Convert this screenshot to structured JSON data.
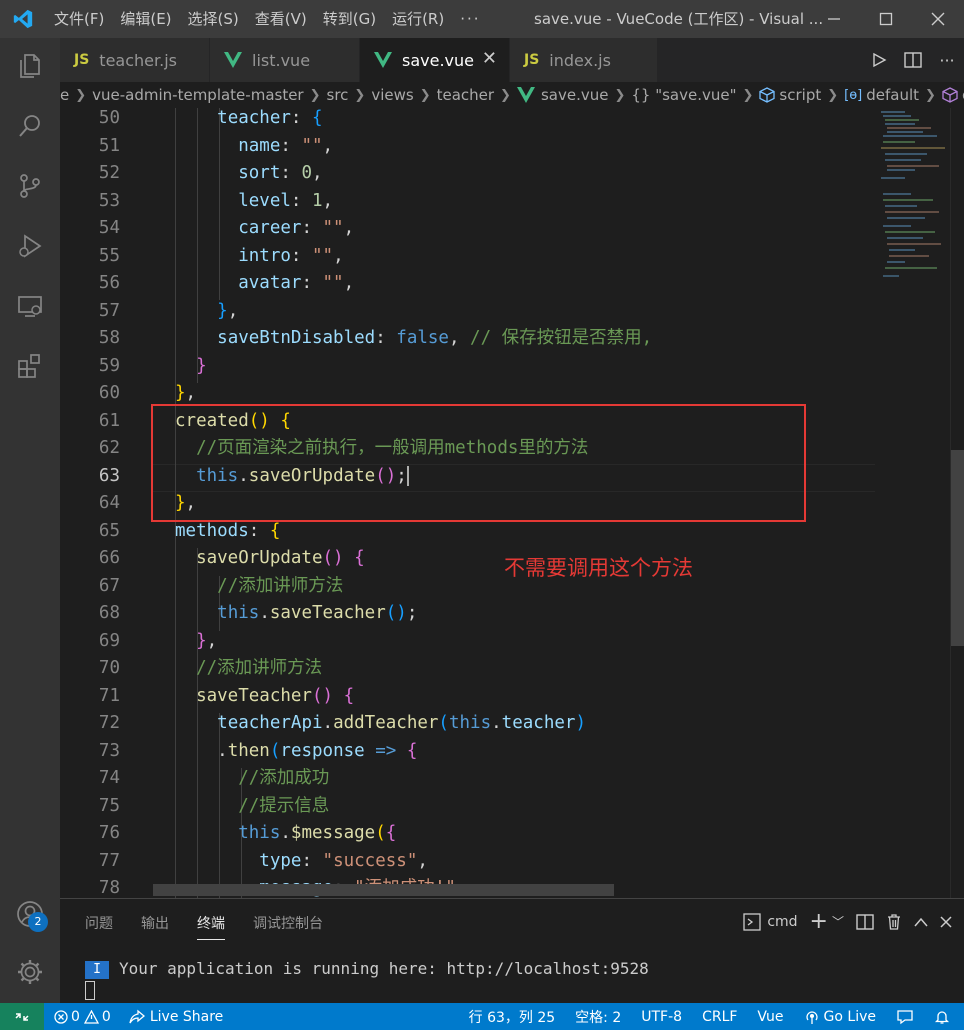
{
  "titlebar": {
    "menu": [
      "文件(F)",
      "编辑(E)",
      "选择(S)",
      "查看(V)",
      "转到(G)",
      "运行(R)"
    ],
    "more": "···",
    "title": "save.vue - VueCode (工作区) - Visual ..."
  },
  "tabs": [
    {
      "label": "teacher.js",
      "kind": "js",
      "active": false
    },
    {
      "label": "list.vue",
      "kind": "vue",
      "active": false
    },
    {
      "label": "save.vue",
      "kind": "vue",
      "active": true
    },
    {
      "label": "index.js",
      "kind": "js",
      "active": false
    }
  ],
  "breadcrumb": [
    "e",
    "vue-admin-template-master",
    "src",
    "views",
    "teacher",
    "save.vue",
    "{} \"save.vue\"",
    "script",
    "default",
    "created"
  ],
  "editor": {
    "current_line": 63,
    "lines": [
      {
        "n": "50"
      },
      {
        "n": "51"
      },
      {
        "n": "52"
      },
      {
        "n": "53"
      },
      {
        "n": "54"
      },
      {
        "n": "55"
      },
      {
        "n": "56"
      },
      {
        "n": "57"
      },
      {
        "n": "58"
      },
      {
        "n": "59"
      },
      {
        "n": "60"
      },
      {
        "n": "61"
      },
      {
        "n": "62"
      },
      {
        "n": "63"
      },
      {
        "n": "64"
      },
      {
        "n": "65"
      },
      {
        "n": "66"
      },
      {
        "n": "67"
      },
      {
        "n": "68"
      },
      {
        "n": "69"
      },
      {
        "n": "70"
      },
      {
        "n": "71"
      },
      {
        "n": "72"
      },
      {
        "n": "73"
      },
      {
        "n": "74"
      },
      {
        "n": "75"
      },
      {
        "n": "76"
      },
      {
        "n": "77"
      },
      {
        "n": "78"
      }
    ],
    "code": {
      "l50": "teacher",
      "l51": "name",
      "l52": "sort",
      "l52v": "0",
      "l53": "level",
      "l53v": "1",
      "l54": "career",
      "l55": "intro",
      "l56": "avatar",
      "empty": "\"\"",
      "l58k": "saveBtnDisabled",
      "l58v": "false",
      "l58c": "// 保存按钮是否禁用,",
      "l61": "created",
      "l62": "//页面渲染之前执行，一般调用methods里的方法",
      "this": "this",
      "l63f": "saveOrUpdate",
      "l65": "methods",
      "l66": "saveOrUpdate",
      "l67": "//添加讲师方法",
      "l68f": "saveTeacher",
      "l70": "//添加讲师方法",
      "l71": "saveTeacher",
      "l72a": "teacherApi",
      "l72b": "addTeacher",
      "l72c": "teacher",
      "l73a": "then",
      "l73b": "response",
      "l74": "//添加成功",
      "l75": "//提示信息",
      "l76": "$message",
      "l77k": "type",
      "l77v": "\"success\"",
      "l78k": "message",
      "l78v": "\"添加成功!\""
    },
    "annotation": "不需要调用这个方法"
  },
  "panel": {
    "tabs": [
      "问题",
      "输出",
      "终端",
      "调试控制台"
    ],
    "active_tab": "终端",
    "shell": "cmd",
    "terminal_text": "Your application is running here: http://localhost:9528"
  },
  "statusbar": {
    "errors": "0",
    "warnings": "0",
    "live_share": "Live Share",
    "position": "行 63，列 25",
    "spaces": "空格: 2",
    "encoding": "UTF-8",
    "eol": "CRLF",
    "language": "Vue",
    "go_live": "Go Live"
  },
  "accounts_badge": "2",
  "colors": {
    "accent": "#007acc",
    "annotation": "#e53935",
    "remote": "#16825d"
  }
}
